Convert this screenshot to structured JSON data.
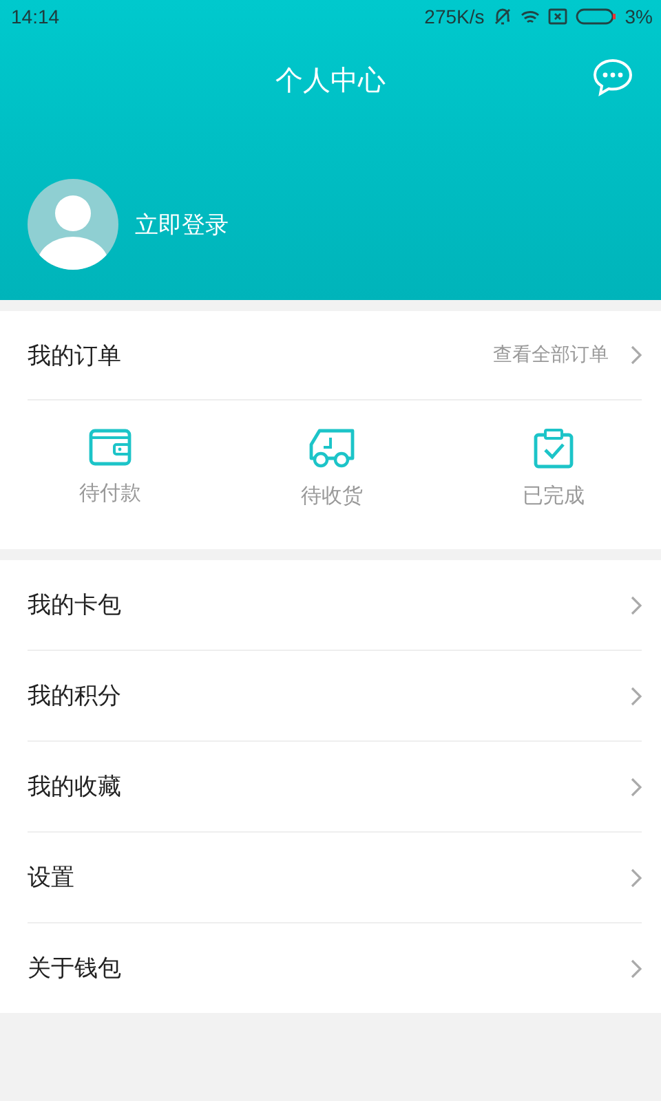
{
  "status_bar": {
    "time": "14:14",
    "speed": "275K/s",
    "battery": "3%"
  },
  "header": {
    "title": "个人中心",
    "login": "立即登录"
  },
  "orders": {
    "title": "我的订单",
    "link": "查看全部订单",
    "items": [
      {
        "kind": "wallet",
        "label": "待付款"
      },
      {
        "kind": "truck",
        "label": "待收货"
      },
      {
        "kind": "done",
        "label": "已完成"
      }
    ]
  },
  "menu": [
    "我的卡包",
    "我的积分",
    "我的收藏",
    "设置",
    "关于钱包"
  ]
}
